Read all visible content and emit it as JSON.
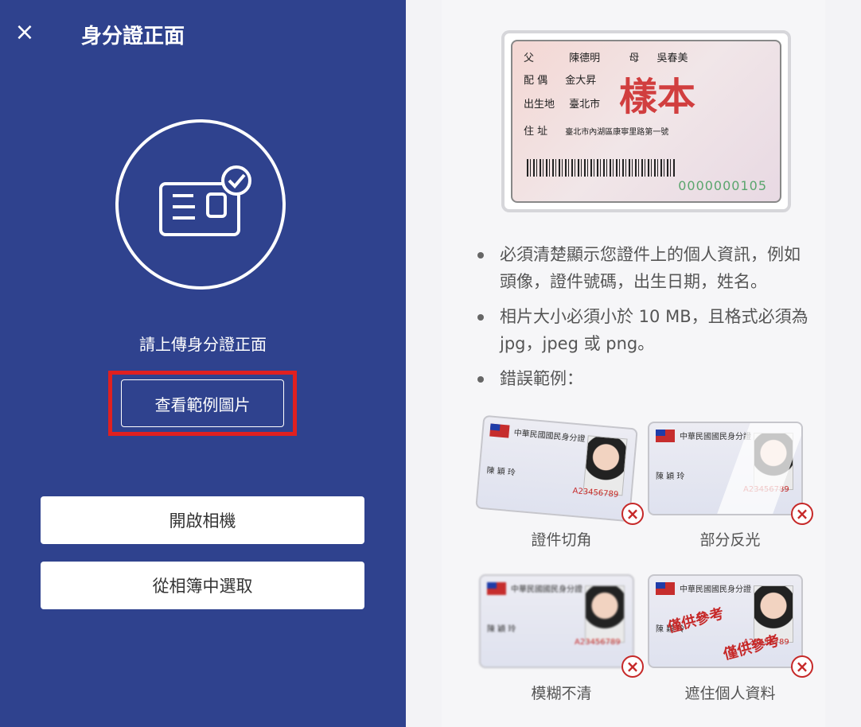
{
  "left": {
    "close_icon": "close-icon",
    "title": "身分證正面",
    "upload_hint": "請上傳身分證正面",
    "sample_button": "查看範例圖片",
    "open_camera": "開啟相機",
    "choose_album": "從相簿中選取"
  },
  "sample_card": {
    "labels": [
      "父",
      "配 偶",
      "出生地",
      "住 址"
    ],
    "values": [
      "陳德明",
      "金大昇",
      "臺北市",
      "臺北市內湖區康寧里路第一號"
    ],
    "mother_label": "母",
    "mother_value": "吳春美",
    "stamp": "樣本",
    "serial": "0000000105"
  },
  "instructions": [
    "必須清楚顯示您證件上的個人資訊，例如頭像，證件號碼，出生日期，姓名。",
    "相片大小必須小於 10 MB，且格式必須為 jpg，jpeg 或 png。",
    "錯誤範例："
  ],
  "examples": [
    {
      "caption": "證件切角",
      "id": "A23456789",
      "name": "陳 穎 玲"
    },
    {
      "caption": "部分反光",
      "id": "A23456789",
      "name": "陳 穎 玲"
    },
    {
      "caption": "模糊不清",
      "id": "A23456789",
      "name": "陳 穎 玲"
    },
    {
      "caption": "遮住個人資料",
      "id": "A23456789",
      "name": "陳 穎 玲"
    }
  ],
  "card_header": "中華民國國民身分證",
  "watermark_text": "僅供參考",
  "colors": {
    "panel_blue": "#2f428e",
    "highlight_red": "#e02020",
    "error_red": "#c62828"
  }
}
